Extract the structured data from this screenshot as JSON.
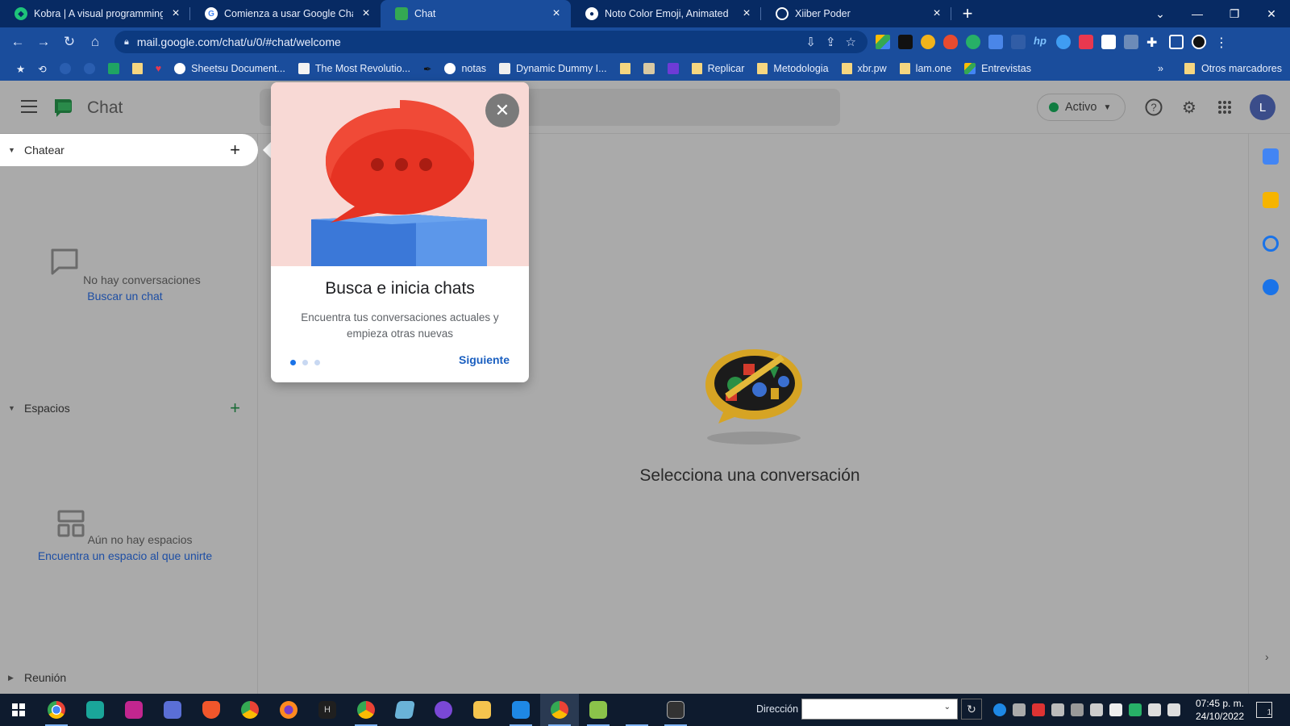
{
  "browser": {
    "tabs": [
      {
        "title": "Kobra | A visual programming lar",
        "favicon_color": "#1ec47a",
        "active": false
      },
      {
        "title": "Comienza a usar Google Chat - (",
        "favicon_color": "#ffffff",
        "active": false
      },
      {
        "title": "Chat",
        "favicon_color": "#34a853",
        "active": true
      },
      {
        "title": "Noto Color Emoji, Animated",
        "favicon_color": "#ffffff",
        "active": false
      },
      {
        "title": "Xiiber Poder",
        "favicon_color": "#ffffff",
        "active": false
      }
    ],
    "url": "mail.google.com/chat/u/0/#chat/welcome",
    "bookmarks": [
      {
        "label": "Sheetsu Document...",
        "icon": "globe-icon"
      },
      {
        "label": "The Most Revolutio...",
        "icon": "site-icon"
      },
      {
        "label": "notas",
        "icon": "globe-icon"
      },
      {
        "label": "Dynamic Dummy I...",
        "icon": "site-icon"
      },
      {
        "label": "Replicar",
        "icon": "folder-icon"
      },
      {
        "label": "Metodologia",
        "icon": "folder-icon"
      },
      {
        "label": "xbr.pw",
        "icon": "folder-icon"
      },
      {
        "label": "lam.one",
        "icon": "folder-icon"
      },
      {
        "label": "Entrevistas",
        "icon": "drive-icon"
      }
    ],
    "more_bookmarks": "»",
    "other_bookmarks": "Otros marcadores"
  },
  "app": {
    "title": "Chat",
    "status": "Activo",
    "avatar_letter": "L",
    "colors": {
      "status": "#107c41",
      "link": "#1d4ea4",
      "accent": "#1a73e8"
    },
    "sidebar": {
      "chat_section": "Chatear",
      "chat_empty": "No hay conversaciones",
      "chat_link": "Buscar un chat",
      "spaces_section": "Espacios",
      "spaces_empty": "Aún no hay espacios",
      "spaces_link": "Encuentra un espacio al que unirte",
      "meeting_section": "Reunión"
    },
    "main": {
      "empty_text": "Selecciona una conversación"
    }
  },
  "popup": {
    "title": "Busca e inicia chats",
    "description": "Encuentra tus conversaciones actuales y empieza otras nuevas",
    "next_label": "Siguiente",
    "page_dots": 3,
    "current_dot": 1
  },
  "taskbar": {
    "address_label": "Dirección",
    "time": "07:45 p. m.",
    "date": "24/10/2022",
    "notification_count": "1"
  }
}
